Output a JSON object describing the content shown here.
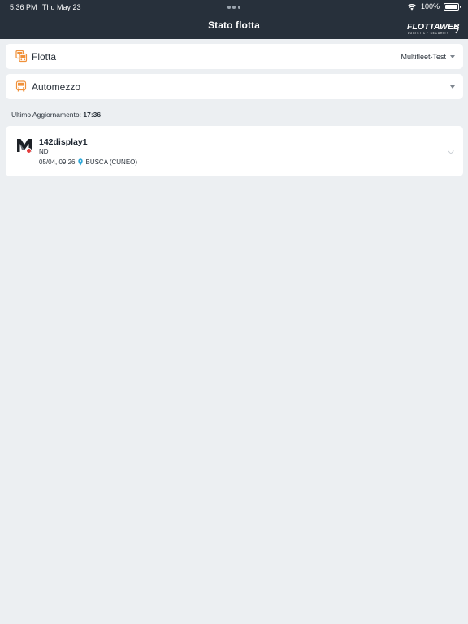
{
  "status_bar": {
    "time": "5:36 PM",
    "date": "Thu May 23",
    "battery": "100%"
  },
  "header": {
    "title": "Stato flotta",
    "brand": {
      "name": "FLOTTAWEB",
      "tagline": "LOGISTIC · SECURITY"
    },
    "background_color": "#27303b"
  },
  "filters": {
    "flotta": {
      "icon": "fleet-icon",
      "label": "Flotta",
      "selected": "Multifleet-Test"
    },
    "automezzo": {
      "icon": "bus-icon",
      "label": "Automezzo",
      "selected": ""
    },
    "icon_color": "#f0913a"
  },
  "last_update": {
    "label": "Ultimo Aggiornamento:",
    "value": "17:36"
  },
  "vehicles": [
    {
      "name": "142display1",
      "status": "ND",
      "datetime": "05/04, 09:26",
      "location": "BUSCA (CUNEO)",
      "avatar_icon": "m-logo-icon",
      "status_color": "#e43c3c"
    }
  ]
}
